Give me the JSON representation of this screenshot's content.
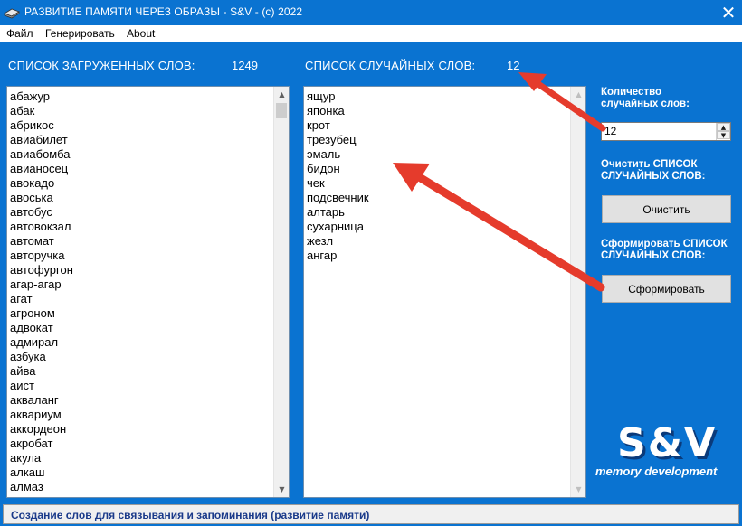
{
  "window": {
    "title": "РАЗВИТИЕ ПАМЯТИ ЧЕРЕЗ ОБРАЗЫ - S&V -  (c) 2022",
    "close_glyph": "✕"
  },
  "menu": {
    "items": [
      "Файл",
      "Генерировать",
      "About"
    ]
  },
  "loaded_list": {
    "header": "СПИСОК ЗАГРУЖЕННЫХ СЛОВ:",
    "count": "1249",
    "items": [
      "абажур",
      "абак",
      "абрикос",
      "авиабилет",
      "авиабомба",
      "авианосец",
      "авокадо",
      "авоська",
      "автобус",
      "автовокзал",
      "автомат",
      "авторучка",
      "автофургон",
      "агар-агар",
      "агат",
      "агроном",
      "адвокат",
      "адмирал",
      "азбука",
      "айва",
      "аист",
      "акваланг",
      "аквариум",
      "аккордеон",
      "акробат",
      "акула",
      "алкаш",
      "алмаз"
    ]
  },
  "random_list": {
    "header": "СПИСОК СЛУЧАЙНЫХ СЛОВ:",
    "count": "12",
    "items": [
      "ящур",
      "японка",
      "крот",
      "трезубец",
      "эмаль",
      "бидон",
      "чек",
      "подсвечник",
      "алтарь",
      "сухарница",
      "жезл",
      "ангар"
    ]
  },
  "side_panel": {
    "count_label_1": "Количество",
    "count_label_2": "случайных слов:",
    "count_value": "12",
    "clear_label_1": "Очистить СПИСОК",
    "clear_label_2": "СЛУЧАЙНЫХ СЛОВ:",
    "clear_button": "Очистить",
    "form_label_1": "Сформировать СПИСОК",
    "form_label_2": "СЛУЧАЙНЫХ СЛОВ:",
    "form_button": "Сформировать"
  },
  "logo": {
    "text": "S&V",
    "subtitle": "memory development"
  },
  "status": {
    "text": "Создание слов для связывания и запоминания (развитие памяти)"
  },
  "colors": {
    "window_bg": "#0a73d1",
    "annotation_arrow": "#e53b2c",
    "status_text": "#1a3a8a"
  },
  "icons": {
    "app": "book-icon",
    "close": "close-icon",
    "scroll_up": "chevron-up-icon",
    "scroll_down": "chevron-down-icon",
    "spin_up": "spin-up-icon",
    "spin_down": "spin-down-icon"
  }
}
